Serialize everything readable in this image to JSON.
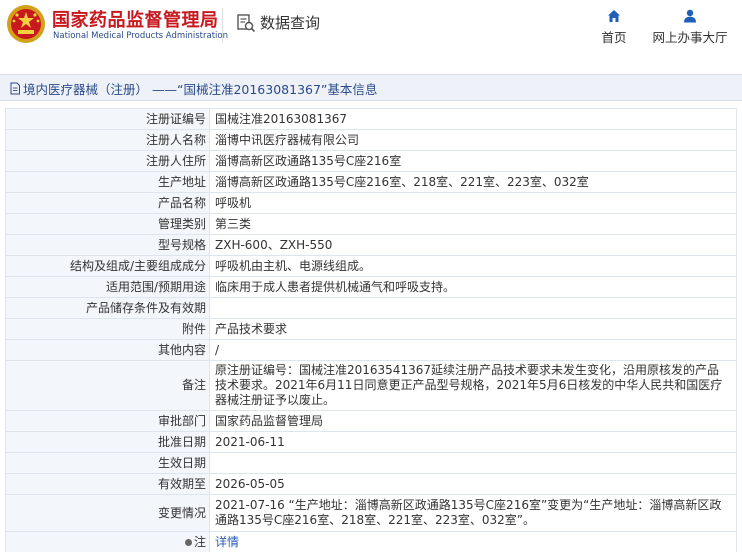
{
  "header": {
    "org_cn": "国家药品监督管理局",
    "org_en": "National Medical Products Administration",
    "query_label": "数据查询",
    "nav": [
      {
        "label": "首页",
        "icon": "home-icon"
      },
      {
        "label": "网上办事大厅",
        "icon": "user-icon"
      }
    ]
  },
  "breadcrumb": {
    "text": "境内医疗器械（注册） ——“国械注准20163081367”基本信息"
  },
  "colors": {
    "brand_red": "#c8191f",
    "nav_blue": "#2a4a8a",
    "key_bg": "#f3f6fa",
    "border": "#dfe5ee",
    "link": "#2a5cb0"
  },
  "record": {
    "rows": [
      {
        "key": "注册证编号",
        "value": "国械注准20163081367"
      },
      {
        "key": "注册人名称",
        "value": "淄博中讯医疗器械有限公司"
      },
      {
        "key": "注册人住所",
        "value": "淄博高新区政通路135号C座216室"
      },
      {
        "key": "生产地址",
        "value": "淄博高新区政通路135号C座216室、218室、221室、223室、032室"
      },
      {
        "key": "产品名称",
        "value": "呼吸机"
      },
      {
        "key": "管理类别",
        "value": "第三类"
      },
      {
        "key": "型号规格",
        "value": "ZXH-600、ZXH-550"
      },
      {
        "key": "结构及组成/主要组成成分",
        "value": "呼吸机由主机、电源线组成。"
      },
      {
        "key": "适用范围/预期用途",
        "value": "临床用于成人患者提供机械通气和呼吸支持。"
      },
      {
        "key": "产品储存条件及有效期",
        "value": ""
      },
      {
        "key": "附件",
        "value": "产品技术要求"
      },
      {
        "key": "其他内容",
        "value": "/"
      },
      {
        "key": "备注",
        "value": "原注册证编号：国械注准20163541367延续注册产品技术要求未发生变化，沿用原核发的产品技术要求。2021年6月11日同意更正产品型号规格，2021年5月6日核发的中华人民共和国医疗器械注册证予以废止。"
      },
      {
        "key": "审批部门",
        "value": "国家药品监督管理局"
      },
      {
        "key": "批准日期",
        "value": "2021-06-11"
      },
      {
        "key": "生效日期",
        "value": ""
      },
      {
        "key": "有效期至",
        "value": "2026-05-05"
      },
      {
        "key": "变更情况",
        "value": "2021-07-16 “生产地址：淄博高新区政通路135号C座216室”变更为“生产地址：淄博高新区政通路135号C座216室、218室、221室、223室、032室”。"
      }
    ],
    "note": {
      "key": "注",
      "value": "详情"
    }
  }
}
